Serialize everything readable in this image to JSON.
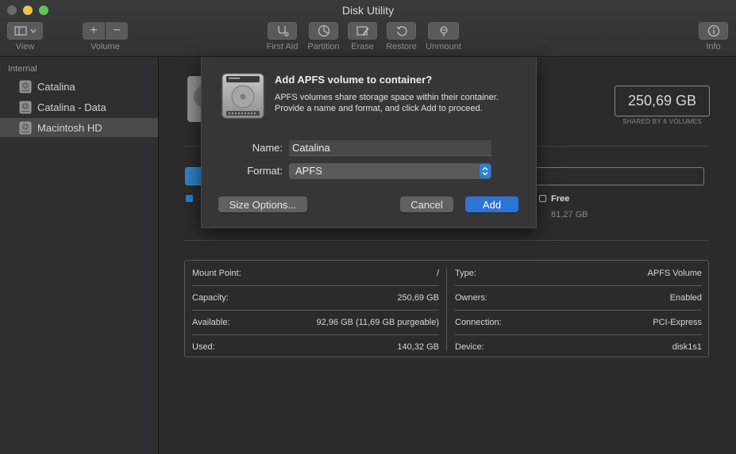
{
  "window": {
    "title": "Disk Utility"
  },
  "toolbar": {
    "view_label": "View",
    "volume_label": "Volume",
    "first_aid_label": "First Aid",
    "partition_label": "Partition",
    "erase_label": "Erase",
    "restore_label": "Restore",
    "unmount_label": "Unmount",
    "info_label": "Info",
    "add_glyph": "+",
    "remove_glyph": "−"
  },
  "sidebar": {
    "header": "Internal",
    "items": [
      {
        "label": "Catalina",
        "selected": false
      },
      {
        "label": "Catalina - Data",
        "selected": false
      },
      {
        "label": "Macintosh HD",
        "selected": true
      }
    ]
  },
  "volume": {
    "capacity": "250,69 GB",
    "shared": "SHARED BY 6 VOLUMES",
    "free_label": "Free",
    "free_value": "81,27 GB"
  },
  "info": {
    "left": [
      {
        "key": "Mount Point:",
        "value": "/"
      },
      {
        "key": "Capacity:",
        "value": "250,69 GB"
      },
      {
        "key": "Available:",
        "value": "92,96 GB (11,69 GB purgeable)"
      },
      {
        "key": "Used:",
        "value": "140,32 GB"
      }
    ],
    "right": [
      {
        "key": "Type:",
        "value": "APFS Volume"
      },
      {
        "key": "Owners:",
        "value": "Enabled"
      },
      {
        "key": "Connection:",
        "value": "PCI-Express"
      },
      {
        "key": "Device:",
        "value": "disk1s1"
      }
    ]
  },
  "dialog": {
    "title": "Add APFS volume to container?",
    "message": "APFS volumes share storage space within their container. Provide a name and format, and click Add to proceed.",
    "name_label": "Name:",
    "name_value": "Catalina",
    "format_label": "Format:",
    "format_value": "APFS",
    "size_options_label": "Size Options...",
    "cancel_label": "Cancel",
    "add_label": "Add"
  },
  "colors": {
    "accent": "#2e73d8",
    "used": "#2a7fc6"
  }
}
